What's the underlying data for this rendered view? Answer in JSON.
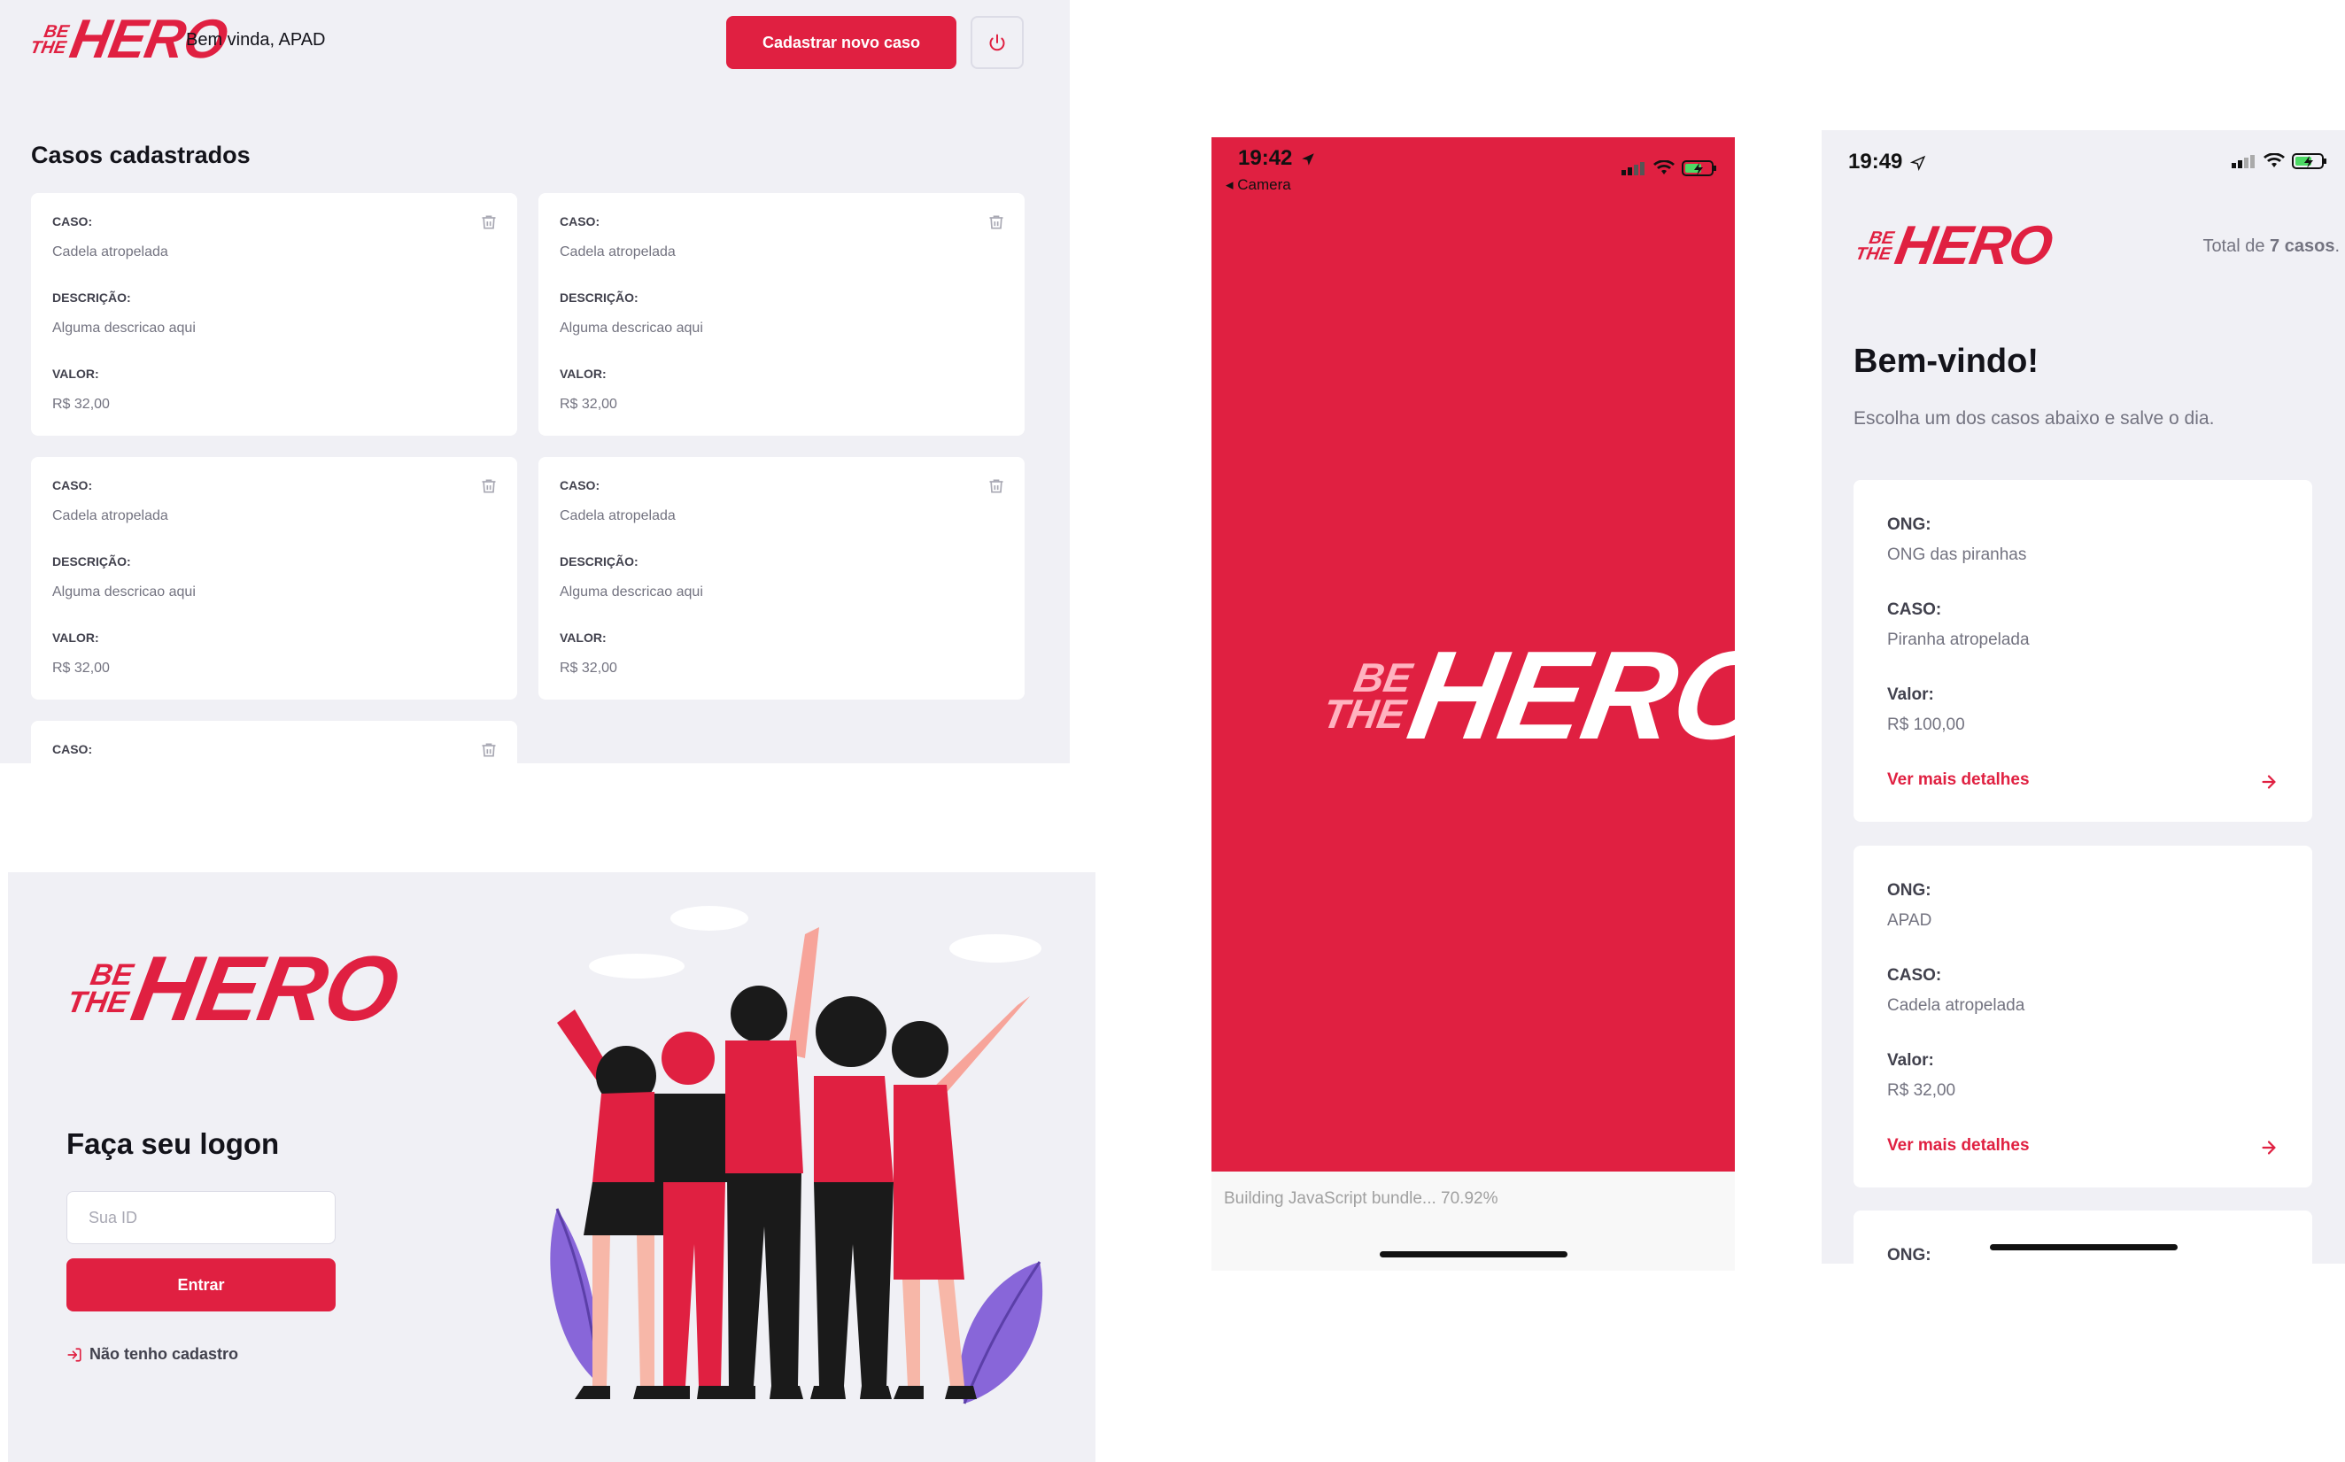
{
  "colors": {
    "brand": "#e02041",
    "bg": "#f0f0f5",
    "text": "#13131a",
    "muted": "#737380",
    "label": "#41414d"
  },
  "logo": {
    "small_top": "BE",
    "small_bottom": "THE",
    "big": "HERO"
  },
  "profile": {
    "welcome": "Bem vinda, APAD",
    "new_case_label": "Cadastrar novo caso",
    "logout_icon": "power-icon",
    "title": "Casos cadastrados",
    "labels": {
      "case": "CASO:",
      "description": "DESCRIÇÃO:",
      "value": "VALOR:"
    },
    "cases": [
      {
        "case": "Cadela atropelada",
        "description": "Alguma descricao aqui",
        "value": "R$ 32,00"
      },
      {
        "case": "Cadela atropelada",
        "description": "Alguma descricao aqui",
        "value": "R$ 32,00"
      },
      {
        "case": "Cadela atropelada",
        "description": "Alguma descricao aqui",
        "value": "R$ 32,00"
      },
      {
        "case": "Cadela atropelada",
        "description": "Alguma descricao aqui",
        "value": "R$ 32,00"
      },
      {
        "case": "",
        "description": "",
        "value": ""
      }
    ]
  },
  "logon": {
    "title": "Faça seu logon",
    "id_placeholder": "Sua ID",
    "submit_label": "Entrar",
    "register_link": "Não tenho cadastro",
    "register_icon": "log-in-icon",
    "illustration": "heroes-illustration"
  },
  "loading": {
    "time": "19:42",
    "back_label": "◂ Camera",
    "bundle_text": "Building JavaScript bundle... 70.92%"
  },
  "mobile": {
    "time": "19:49",
    "total_prefix": "Total de ",
    "total_count": "7 casos",
    "total_suffix": ".",
    "welcome": "Bem-vindo!",
    "subtitle": "Escolha um dos casos abaixo e salve o dia.",
    "labels": {
      "ong": "ONG:",
      "case": "CASO:",
      "value": "Valor:"
    },
    "more_label": "Ver mais detalhes",
    "incidents": [
      {
        "ong": "ONG das piranhas",
        "case": "Piranha atropelada",
        "value": "R$ 100,00"
      },
      {
        "ong": "APAD",
        "case": "Cadela atropelada",
        "value": "R$ 32,00"
      },
      {
        "ong": "",
        "case": "",
        "value": ""
      }
    ]
  }
}
